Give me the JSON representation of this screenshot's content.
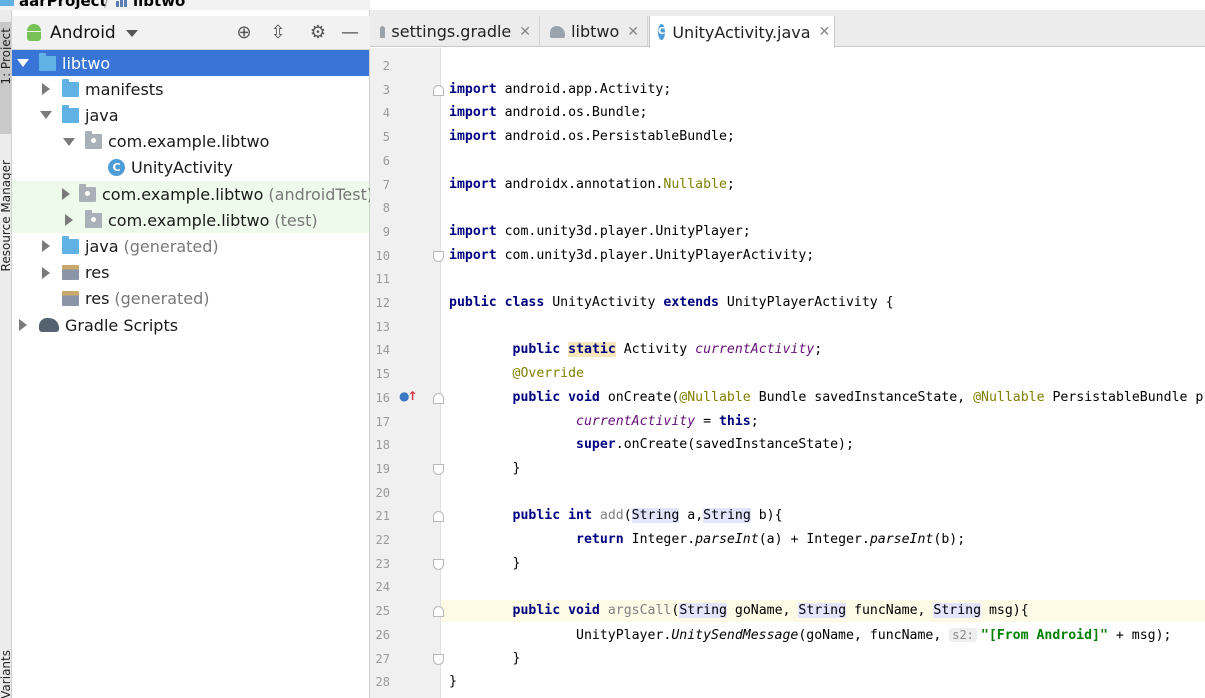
{
  "breadcrumb": {
    "project": "aarProject",
    "module": "libtwo"
  },
  "stripe": {
    "project_tab": "1: Project",
    "resource_tab": "Resource Manager",
    "variants_tab": "Variants"
  },
  "project_panel": {
    "view_mode": "Android",
    "tree": [
      {
        "label": "libtwo",
        "suffix": "",
        "depth": 0,
        "arrow": "down",
        "icon": "module-icon",
        "selected": true,
        "test": false
      },
      {
        "label": "manifests",
        "suffix": "",
        "depth": 1,
        "arrow": "right",
        "icon": "folder-icon",
        "selected": false,
        "test": false
      },
      {
        "label": "java",
        "suffix": "",
        "depth": 1,
        "arrow": "down",
        "icon": "folder-icon",
        "selected": false,
        "test": false
      },
      {
        "label": "com.example.libtwo",
        "suffix": "",
        "depth": 2,
        "arrow": "down",
        "icon": "package-icon",
        "selected": false,
        "test": false
      },
      {
        "label": "UnityActivity",
        "suffix": "",
        "depth": 3,
        "arrow": "none",
        "icon": "class-icon",
        "selected": false,
        "test": false
      },
      {
        "label": "com.example.libtwo",
        "suffix": "(androidTest)",
        "depth": 2,
        "arrow": "right",
        "icon": "package-icon",
        "selected": false,
        "test": true
      },
      {
        "label": "com.example.libtwo",
        "suffix": "(test)",
        "depth": 2,
        "arrow": "right",
        "icon": "package-icon",
        "selected": false,
        "test": true
      },
      {
        "label": "java",
        "suffix": "(generated)",
        "depth": 1,
        "arrow": "right",
        "icon": "generated-folder-icon",
        "selected": false,
        "test": false
      },
      {
        "label": "res",
        "suffix": "",
        "depth": 1,
        "arrow": "right",
        "icon": "res-folder-icon",
        "selected": false,
        "test": false
      },
      {
        "label": "res",
        "suffix": "(generated)",
        "depth": 1,
        "arrow": "none",
        "icon": "res-folder-icon",
        "selected": false,
        "test": false
      },
      {
        "label": "Gradle Scripts",
        "suffix": "",
        "depth": 0,
        "arrow": "right",
        "icon": "gradle-icon",
        "selected": false,
        "test": false
      }
    ]
  },
  "tabs": [
    {
      "label": "settings.gradle",
      "icon": "gradle-icon",
      "active": false
    },
    {
      "label": "libtwo",
      "icon": "gradle-icon",
      "active": false
    },
    {
      "label": "UnityActivity.java",
      "icon": "class-icon",
      "active": true
    }
  ],
  "code_lines": [
    {
      "n": "2",
      "html": ""
    },
    {
      "n": "3",
      "html": "<span class='kw'>import</span> android.app.Activity;"
    },
    {
      "n": "4",
      "html": "<span class='kw'>import</span> android.os.Bundle;"
    },
    {
      "n": "5",
      "html": "<span class='kw'>import</span> android.os.PersistableBundle;"
    },
    {
      "n": "6",
      "html": ""
    },
    {
      "n": "7",
      "html": "<span class='kw'>import</span> androidx.annotation.<span class='ann'>Nullable</span>;"
    },
    {
      "n": "8",
      "html": ""
    },
    {
      "n": "9",
      "html": "<span class='kw'>import</span> com.unity3d.player.UnityPlayer;"
    },
    {
      "n": "10",
      "html": "<span class='kw'>import</span> com.unity3d.player.UnityPlayerActivity;"
    },
    {
      "n": "11",
      "html": ""
    },
    {
      "n": "12",
      "html": "<span class='kw'>public class</span> UnityActivity <span class='kw'>extends</span> UnityPlayerActivity {"
    },
    {
      "n": "13",
      "html": ""
    },
    {
      "n": "14",
      "html": "        <span class='kw'>public</span> <span class='kw stat-hl'>static</span> Activity <span class='fld'>currentActivity</span>;"
    },
    {
      "n": "15",
      "html": "        <span class='ann'>@Override</span>"
    },
    {
      "n": "16",
      "html": "        <span class='kw'>public void</span> onCreate(<span class='ann'>@Nullable</span> Bundle savedInstanceState, <span class='ann'>@Nullable</span> PersistableBundle p"
    },
    {
      "n": "17",
      "html": "                <span class='fld'>currentActivity</span> = <span class='kw'>this</span>;"
    },
    {
      "n": "18",
      "html": "                <span class='kw'>super</span>.onCreate(savedInstanceState);"
    },
    {
      "n": "19",
      "html": "        }"
    },
    {
      "n": "20",
      "html": ""
    },
    {
      "n": "21",
      "html": "        <span class='kw'>public int</span> <span class='unused'>add</span>(<span class='tbg'>String</span> a,<span class='tbg'>String</span> b){"
    },
    {
      "n": "22",
      "html": "                <span class='kw'>return</span> Integer.<span class='st'>parseInt</span>(a) + Integer.<span class='st'>parseInt</span>(b);"
    },
    {
      "n": "23",
      "html": "        }"
    },
    {
      "n": "24",
      "html": ""
    },
    {
      "n": "25",
      "html": "        <span class='kw'>public void</span> <span class='unused'>argsCall</span>(<span class='tbg'>String</span> goName, <span class='tbg'>String</span> funcName, <span class='tbg'>String</span> msg){"
    },
    {
      "n": "26",
      "html": "                UnityPlayer.<span class='st'>UnitySendMessage</span>(goName, funcName, <span class='hint'>s2:</span><span class='str'>\"[From Android]\"</span> + msg);"
    },
    {
      "n": "27",
      "html": "        }"
    },
    {
      "n": "28",
      "html": "}"
    }
  ]
}
